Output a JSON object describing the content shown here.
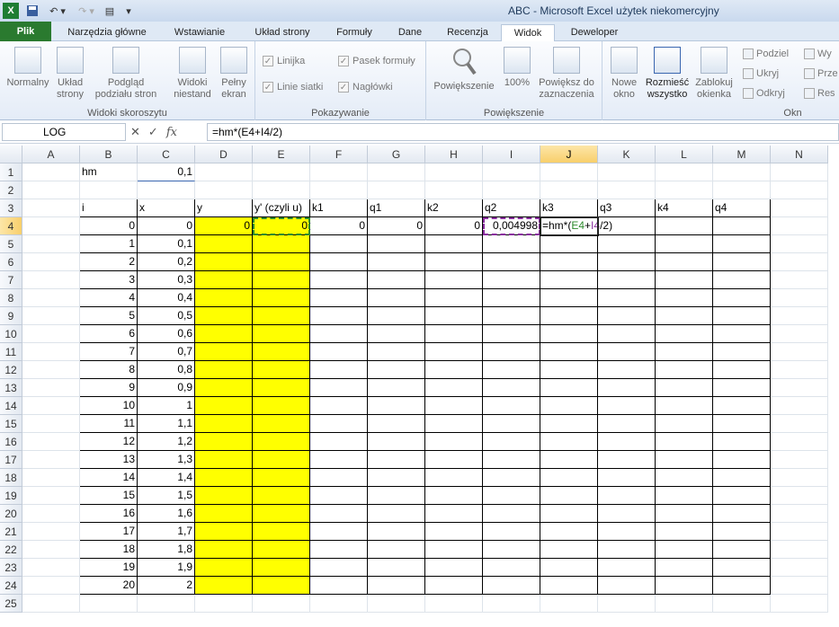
{
  "window": {
    "title": "ABC  -  Microsoft Excel użytek niekomercyjny"
  },
  "tabs": [
    "Plik",
    "Narzędzia główne",
    "Wstawianie",
    "Układ strony",
    "Formuły",
    "Dane",
    "Recenzja",
    "Widok",
    "Deweloper"
  ],
  "ribbon": {
    "views": {
      "label": "Widoki skoroszytu",
      "normal": "Normalny",
      "layout": "Układ\nstrony",
      "preview": "Podgląd\npodziału stron",
      "custom": "Widoki\nniestand",
      "full": "Pełny\nekran"
    },
    "show": {
      "label": "Pokazywanie",
      "ruler": "Linijka",
      "gridlines": "Linie siatki",
      "fbar": "Pasek formuły",
      "headers": "Nagłówki"
    },
    "zoom": {
      "label": "Powiększenie",
      "zoom": "Powiększenie",
      "zoom100": "100%",
      "zoomsel": "Powiększ do\nzaznaczenia"
    },
    "window": {
      "newwin": "Nowe\nokno",
      "arrange": "Rozmieść\nwszystko",
      "freeze": "Zablokuj\nokienka",
      "split": "Podziel",
      "hide": "Ukryj",
      "unhide": "Odkryj",
      "w1": "Wy",
      "w2": "Prze",
      "w3": "Res",
      "lbl": "Okn"
    }
  },
  "formula_bar": {
    "name_box": "LOG",
    "formula": "=hm*(E4+I4/2)"
  },
  "columns": [
    "A",
    "B",
    "C",
    "D",
    "E",
    "F",
    "G",
    "H",
    "I",
    "J",
    "K",
    "L",
    "M",
    "N"
  ],
  "rows": [
    "1",
    "2",
    "3",
    "4",
    "5",
    "6",
    "7",
    "8",
    "9",
    "10",
    "11",
    "12",
    "13",
    "14",
    "15",
    "16",
    "17",
    "18",
    "19",
    "20",
    "21",
    "22",
    "23",
    "24",
    "25"
  ],
  "cells": {
    "B1": "hm",
    "C1": "0,1",
    "B3": "i",
    "C3": "x",
    "D3": "y",
    "E3": "y' (czyli u)",
    "F3": "k1",
    "G3": "q1",
    "H3": "k2",
    "I3": "q2",
    "J3": "k3",
    "K3": "q3",
    "L3": "k4",
    "M3": "q4",
    "D4": "0",
    "E4": "0",
    "F4": "0",
    "G4": "0",
    "H4": "0",
    "I4": "0,004998"
  },
  "i_values": [
    "0",
    "1",
    "2",
    "3",
    "4",
    "5",
    "6",
    "7",
    "8",
    "9",
    "10",
    "11",
    "12",
    "13",
    "14",
    "15",
    "16",
    "17",
    "18",
    "19",
    "20"
  ],
  "x_values": [
    "0",
    "0,1",
    "0,2",
    "0,3",
    "0,4",
    "0,5",
    "0,6",
    "0,7",
    "0,8",
    "0,9",
    "1",
    "1,1",
    "1,2",
    "1,3",
    "1,4",
    "1,5",
    "1,6",
    "1,7",
    "1,8",
    "1,9",
    "2"
  ],
  "edit": {
    "p1": "=hm*(",
    "p2": "E4",
    "p3": "+",
    "p4": "I4",
    "p5": "/2)"
  },
  "colors": {
    "green_ref": "#2e8b2e",
    "purple_ref": "#8b2fa0",
    "highlight": "#ffff00"
  }
}
